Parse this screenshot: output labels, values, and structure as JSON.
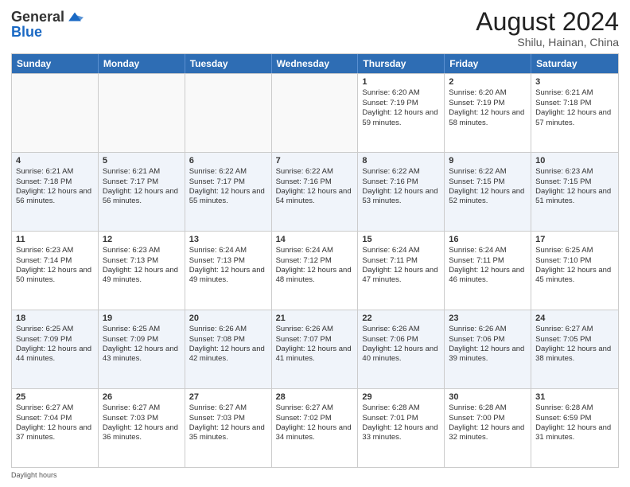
{
  "header": {
    "logo_general": "General",
    "logo_blue": "Blue",
    "month_year": "August 2024",
    "location": "Shilu, Hainan, China"
  },
  "days_of_week": [
    "Sunday",
    "Monday",
    "Tuesday",
    "Wednesday",
    "Thursday",
    "Friday",
    "Saturday"
  ],
  "rows": [
    [
      {
        "day": "",
        "sunrise": "",
        "sunset": "",
        "daylight": "",
        "empty": true
      },
      {
        "day": "",
        "sunrise": "",
        "sunset": "",
        "daylight": "",
        "empty": true
      },
      {
        "day": "",
        "sunrise": "",
        "sunset": "",
        "daylight": "",
        "empty": true
      },
      {
        "day": "",
        "sunrise": "",
        "sunset": "",
        "daylight": "",
        "empty": true
      },
      {
        "day": "1",
        "sunrise": "Sunrise: 6:20 AM",
        "sunset": "Sunset: 7:19 PM",
        "daylight": "Daylight: 12 hours and 59 minutes."
      },
      {
        "day": "2",
        "sunrise": "Sunrise: 6:20 AM",
        "sunset": "Sunset: 7:19 PM",
        "daylight": "Daylight: 12 hours and 58 minutes."
      },
      {
        "day": "3",
        "sunrise": "Sunrise: 6:21 AM",
        "sunset": "Sunset: 7:18 PM",
        "daylight": "Daylight: 12 hours and 57 minutes."
      }
    ],
    [
      {
        "day": "4",
        "sunrise": "Sunrise: 6:21 AM",
        "sunset": "Sunset: 7:18 PM",
        "daylight": "Daylight: 12 hours and 56 minutes."
      },
      {
        "day": "5",
        "sunrise": "Sunrise: 6:21 AM",
        "sunset": "Sunset: 7:17 PM",
        "daylight": "Daylight: 12 hours and 56 minutes."
      },
      {
        "day": "6",
        "sunrise": "Sunrise: 6:22 AM",
        "sunset": "Sunset: 7:17 PM",
        "daylight": "Daylight: 12 hours and 55 minutes."
      },
      {
        "day": "7",
        "sunrise": "Sunrise: 6:22 AM",
        "sunset": "Sunset: 7:16 PM",
        "daylight": "Daylight: 12 hours and 54 minutes."
      },
      {
        "day": "8",
        "sunrise": "Sunrise: 6:22 AM",
        "sunset": "Sunset: 7:16 PM",
        "daylight": "Daylight: 12 hours and 53 minutes."
      },
      {
        "day": "9",
        "sunrise": "Sunrise: 6:22 AM",
        "sunset": "Sunset: 7:15 PM",
        "daylight": "Daylight: 12 hours and 52 minutes."
      },
      {
        "day": "10",
        "sunrise": "Sunrise: 6:23 AM",
        "sunset": "Sunset: 7:15 PM",
        "daylight": "Daylight: 12 hours and 51 minutes."
      }
    ],
    [
      {
        "day": "11",
        "sunrise": "Sunrise: 6:23 AM",
        "sunset": "Sunset: 7:14 PM",
        "daylight": "Daylight: 12 hours and 50 minutes."
      },
      {
        "day": "12",
        "sunrise": "Sunrise: 6:23 AM",
        "sunset": "Sunset: 7:13 PM",
        "daylight": "Daylight: 12 hours and 49 minutes."
      },
      {
        "day": "13",
        "sunrise": "Sunrise: 6:24 AM",
        "sunset": "Sunset: 7:13 PM",
        "daylight": "Daylight: 12 hours and 49 minutes."
      },
      {
        "day": "14",
        "sunrise": "Sunrise: 6:24 AM",
        "sunset": "Sunset: 7:12 PM",
        "daylight": "Daylight: 12 hours and 48 minutes."
      },
      {
        "day": "15",
        "sunrise": "Sunrise: 6:24 AM",
        "sunset": "Sunset: 7:11 PM",
        "daylight": "Daylight: 12 hours and 47 minutes."
      },
      {
        "day": "16",
        "sunrise": "Sunrise: 6:24 AM",
        "sunset": "Sunset: 7:11 PM",
        "daylight": "Daylight: 12 hours and 46 minutes."
      },
      {
        "day": "17",
        "sunrise": "Sunrise: 6:25 AM",
        "sunset": "Sunset: 7:10 PM",
        "daylight": "Daylight: 12 hours and 45 minutes."
      }
    ],
    [
      {
        "day": "18",
        "sunrise": "Sunrise: 6:25 AM",
        "sunset": "Sunset: 7:09 PM",
        "daylight": "Daylight: 12 hours and 44 minutes."
      },
      {
        "day": "19",
        "sunrise": "Sunrise: 6:25 AM",
        "sunset": "Sunset: 7:09 PM",
        "daylight": "Daylight: 12 hours and 43 minutes."
      },
      {
        "day": "20",
        "sunrise": "Sunrise: 6:26 AM",
        "sunset": "Sunset: 7:08 PM",
        "daylight": "Daylight: 12 hours and 42 minutes."
      },
      {
        "day": "21",
        "sunrise": "Sunrise: 6:26 AM",
        "sunset": "Sunset: 7:07 PM",
        "daylight": "Daylight: 12 hours and 41 minutes."
      },
      {
        "day": "22",
        "sunrise": "Sunrise: 6:26 AM",
        "sunset": "Sunset: 7:06 PM",
        "daylight": "Daylight: 12 hours and 40 minutes."
      },
      {
        "day": "23",
        "sunrise": "Sunrise: 6:26 AM",
        "sunset": "Sunset: 7:06 PM",
        "daylight": "Daylight: 12 hours and 39 minutes."
      },
      {
        "day": "24",
        "sunrise": "Sunrise: 6:27 AM",
        "sunset": "Sunset: 7:05 PM",
        "daylight": "Daylight: 12 hours and 38 minutes."
      }
    ],
    [
      {
        "day": "25",
        "sunrise": "Sunrise: 6:27 AM",
        "sunset": "Sunset: 7:04 PM",
        "daylight": "Daylight: 12 hours and 37 minutes."
      },
      {
        "day": "26",
        "sunrise": "Sunrise: 6:27 AM",
        "sunset": "Sunset: 7:03 PM",
        "daylight": "Daylight: 12 hours and 36 minutes."
      },
      {
        "day": "27",
        "sunrise": "Sunrise: 6:27 AM",
        "sunset": "Sunset: 7:03 PM",
        "daylight": "Daylight: 12 hours and 35 minutes."
      },
      {
        "day": "28",
        "sunrise": "Sunrise: 6:27 AM",
        "sunset": "Sunset: 7:02 PM",
        "daylight": "Daylight: 12 hours and 34 minutes."
      },
      {
        "day": "29",
        "sunrise": "Sunrise: 6:28 AM",
        "sunset": "Sunset: 7:01 PM",
        "daylight": "Daylight: 12 hours and 33 minutes."
      },
      {
        "day": "30",
        "sunrise": "Sunrise: 6:28 AM",
        "sunset": "Sunset: 7:00 PM",
        "daylight": "Daylight: 12 hours and 32 minutes."
      },
      {
        "day": "31",
        "sunrise": "Sunrise: 6:28 AM",
        "sunset": "Sunset: 6:59 PM",
        "daylight": "Daylight: 12 hours and 31 minutes."
      }
    ]
  ],
  "footer": {
    "daylight_label": "Daylight hours"
  }
}
